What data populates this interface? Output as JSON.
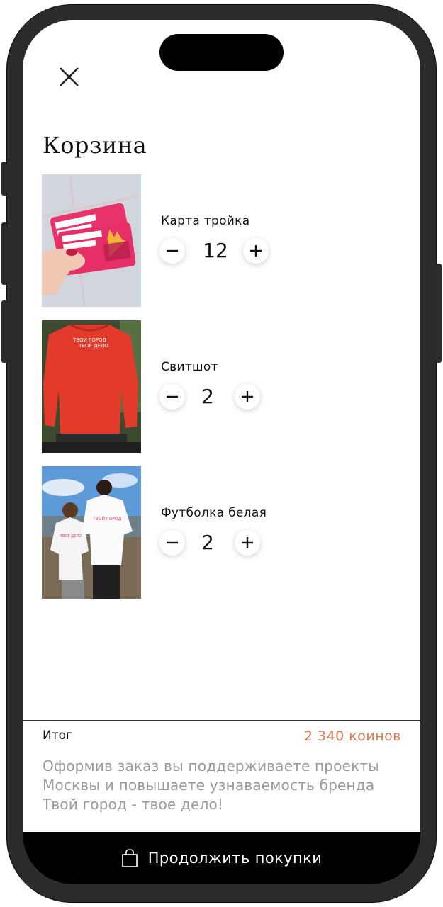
{
  "header": {
    "close_icon": "close-icon",
    "title": "Корзина"
  },
  "items": [
    {
      "name": "Карта тройка",
      "quantity": "12",
      "image": "metro-cards-photo"
    },
    {
      "name": "Свитшот",
      "quantity": "2",
      "image": "red-sweatshirt-photo"
    },
    {
      "name": "Футболка белая",
      "quantity": "2",
      "image": "couple-white-tshirts-photo"
    }
  ],
  "summary": {
    "total_label": "Итог",
    "total_value": "2 340 коинов",
    "note": "Оформив заказ вы поддерживаете проекты Москвы и повышаете узнаваемость бренда Твой город - твое дело!"
  },
  "footer": {
    "button_icon": "shopping-bag-icon",
    "button_label": "Продолжить покупки"
  },
  "colors": {
    "accent": "#e07a4f",
    "muted_text": "#9a9a9a",
    "bar": "#000000"
  }
}
